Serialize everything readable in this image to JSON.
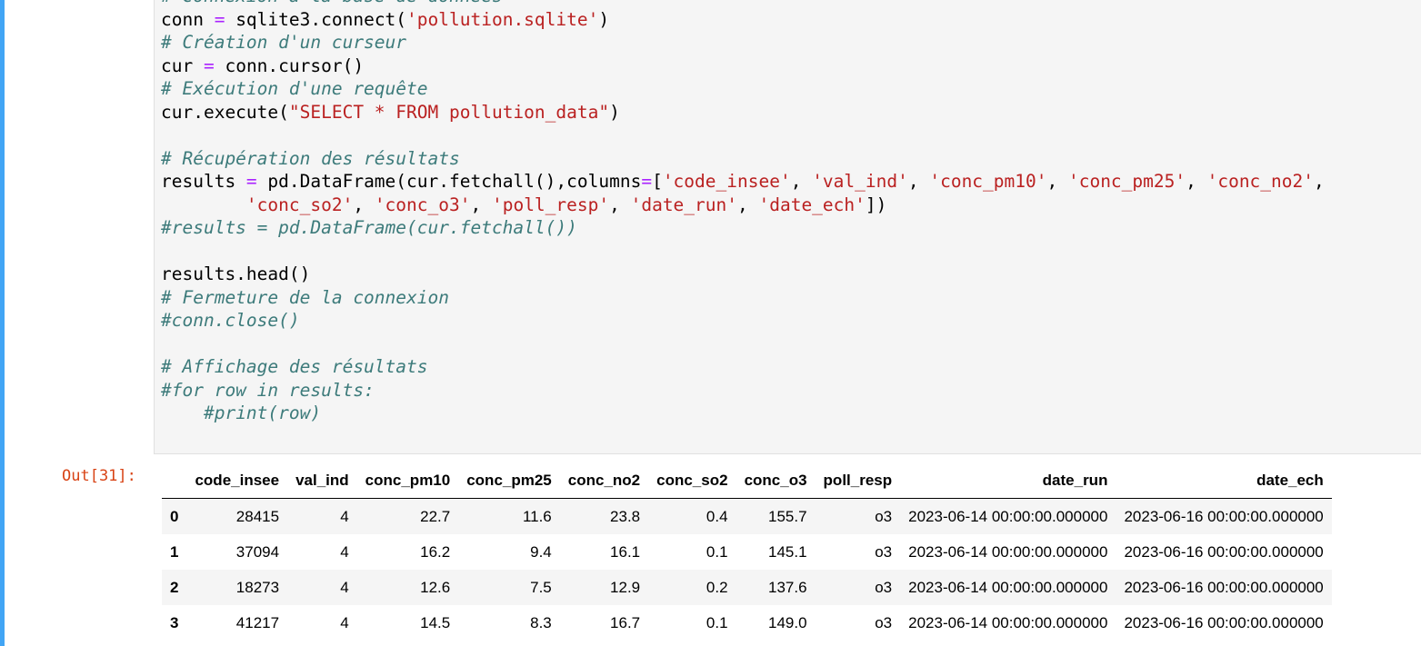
{
  "notebook": {
    "code_lines": [
      [
        {
          "t": "com",
          "v": "# Connexion à la base de données"
        }
      ],
      [
        {
          "t": "txt",
          "v": "conn "
        },
        {
          "t": "op",
          "v": "="
        },
        {
          "t": "txt",
          "v": " sqlite3.connect("
        },
        {
          "t": "str",
          "v": "'pollution.sqlite'"
        },
        {
          "t": "txt",
          "v": ")"
        }
      ],
      [
        {
          "t": "com",
          "v": "# Création d'un curseur"
        }
      ],
      [
        {
          "t": "txt",
          "v": "cur "
        },
        {
          "t": "op",
          "v": "="
        },
        {
          "t": "txt",
          "v": " conn.cursor()"
        }
      ],
      [
        {
          "t": "com",
          "v": "# Exécution d'une requête"
        }
      ],
      [
        {
          "t": "txt",
          "v": "cur.execute("
        },
        {
          "t": "str",
          "v": "\"SELECT * FROM pollution_data\""
        },
        {
          "t": "txt",
          "v": ")"
        }
      ],
      [],
      [
        {
          "t": "com",
          "v": "# Récupération des résultats"
        }
      ],
      [
        {
          "t": "txt",
          "v": "results "
        },
        {
          "t": "op",
          "v": "="
        },
        {
          "t": "txt",
          "v": " pd.DataFrame(cur.fetchall(),columns"
        },
        {
          "t": "op",
          "v": "="
        },
        {
          "t": "txt",
          "v": "["
        },
        {
          "t": "str",
          "v": "'code_insee'"
        },
        {
          "t": "txt",
          "v": ", "
        },
        {
          "t": "str",
          "v": "'val_ind'"
        },
        {
          "t": "txt",
          "v": ", "
        },
        {
          "t": "str",
          "v": "'conc_pm10'"
        },
        {
          "t": "txt",
          "v": ", "
        },
        {
          "t": "str",
          "v": "'conc_pm25'"
        },
        {
          "t": "txt",
          "v": ", "
        },
        {
          "t": "str",
          "v": "'conc_no2'"
        },
        {
          "t": "txt",
          "v": ","
        }
      ],
      [
        {
          "t": "txt",
          "v": "        "
        },
        {
          "t": "str",
          "v": "'conc_so2'"
        },
        {
          "t": "txt",
          "v": ", "
        },
        {
          "t": "str",
          "v": "'conc_o3'"
        },
        {
          "t": "txt",
          "v": ", "
        },
        {
          "t": "str",
          "v": "'poll_resp'"
        },
        {
          "t": "txt",
          "v": ", "
        },
        {
          "t": "str",
          "v": "'date_run'"
        },
        {
          "t": "txt",
          "v": ", "
        },
        {
          "t": "str",
          "v": "'date_ech'"
        },
        {
          "t": "txt",
          "v": "])"
        }
      ],
      [
        {
          "t": "com",
          "v": "#results = pd.DataFrame(cur.fetchall())"
        }
      ],
      [],
      [
        {
          "t": "txt",
          "v": "results.head()"
        }
      ],
      [
        {
          "t": "com",
          "v": "# Fermeture de la connexion"
        }
      ],
      [
        {
          "t": "com",
          "v": "#conn.close()"
        }
      ],
      [],
      [
        {
          "t": "com",
          "v": "# Affichage des résultats"
        }
      ],
      [
        {
          "t": "com",
          "v": "#for row in results:"
        }
      ],
      [
        {
          "t": "txt",
          "v": "    "
        },
        {
          "t": "com",
          "v": "#print(row)"
        }
      ]
    ],
    "output_prompt": "Out[31]:",
    "table": {
      "columns": [
        "code_insee",
        "val_ind",
        "conc_pm10",
        "conc_pm25",
        "conc_no2",
        "conc_so2",
        "conc_o3",
        "poll_resp",
        "date_run",
        "date_ech"
      ],
      "rows": [
        [
          "0",
          "28415",
          "4",
          "22.7",
          "11.6",
          "23.8",
          "0.4",
          "155.7",
          "o3",
          "2023-06-14 00:00:00.000000",
          "2023-06-16 00:00:00.000000"
        ],
        [
          "1",
          "37094",
          "4",
          "16.2",
          "9.4",
          "16.1",
          "0.1",
          "145.1",
          "o3",
          "2023-06-14 00:00:00.000000",
          "2023-06-16 00:00:00.000000"
        ],
        [
          "2",
          "18273",
          "4",
          "12.6",
          "7.5",
          "12.9",
          "0.2",
          "137.6",
          "o3",
          "2023-06-14 00:00:00.000000",
          "2023-06-16 00:00:00.000000"
        ],
        [
          "3",
          "41217",
          "4",
          "14.5",
          "8.3",
          "16.7",
          "0.1",
          "149.0",
          "o3",
          "2023-06-14 00:00:00.000000",
          "2023-06-16 00:00:00.000000"
        ]
      ]
    },
    "colors": {
      "selection_bar": "#42a5f5",
      "keyword_operator": "#aa22ff",
      "string": "#ba2121",
      "comment": "#3d7b7b",
      "output_prompt": "#d84315"
    }
  }
}
